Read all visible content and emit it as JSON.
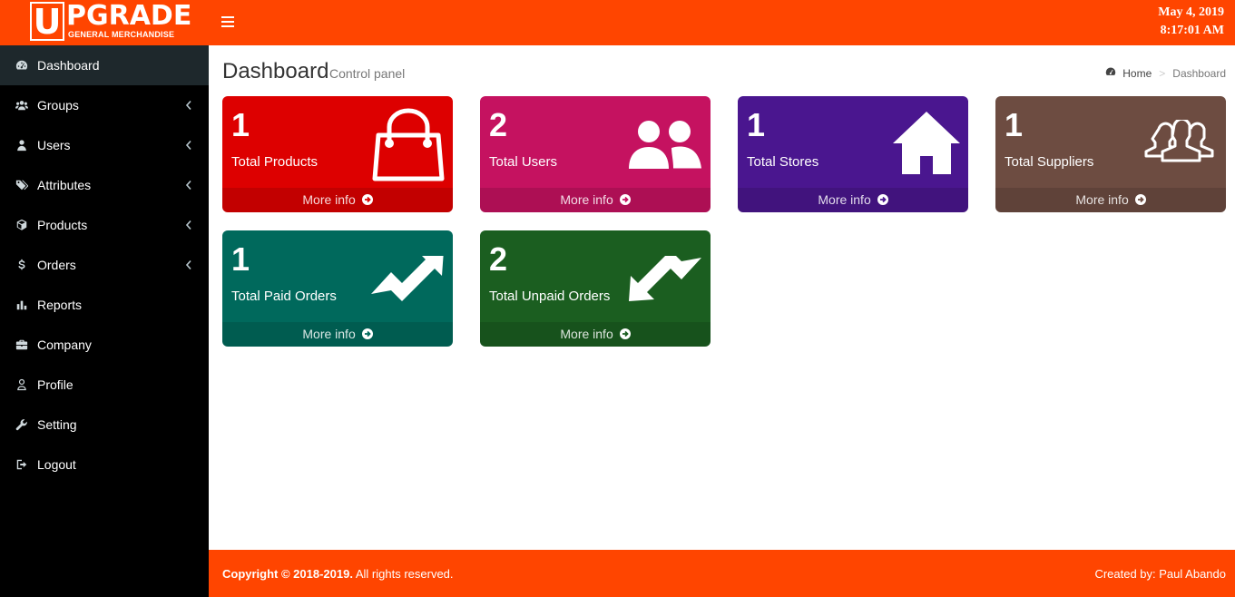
{
  "header": {
    "logo": {
      "first_letter": "U",
      "rest": "PGRADE",
      "subtitle": "GENERAL MERCHANDISE"
    },
    "menu_icon": "hamburger-icon",
    "date": "May 4, 2019",
    "time": "8:17:01 AM",
    "brand_color": "#ff4500"
  },
  "sidebar": {
    "items": [
      {
        "label": "Dashboard",
        "icon": "dashboard-icon",
        "active": true,
        "has_submenu": false
      },
      {
        "label": "Groups",
        "icon": "users-group-icon",
        "active": false,
        "has_submenu": true
      },
      {
        "label": "Users",
        "icon": "user-icon",
        "active": false,
        "has_submenu": true
      },
      {
        "label": "Attributes",
        "icon": "tags-icon",
        "active": false,
        "has_submenu": true
      },
      {
        "label": "Products",
        "icon": "cube-icon",
        "active": false,
        "has_submenu": true
      },
      {
        "label": "Orders",
        "icon": "dollar-icon",
        "active": false,
        "has_submenu": true
      },
      {
        "label": "Reports",
        "icon": "bar-chart-icon",
        "active": false,
        "has_submenu": false
      },
      {
        "label": "Company",
        "icon": "briefcase-icon",
        "active": false,
        "has_submenu": false
      },
      {
        "label": "Profile",
        "icon": "user-outline-icon",
        "active": false,
        "has_submenu": false
      },
      {
        "label": "Setting",
        "icon": "wrench-icon",
        "active": false,
        "has_submenu": false
      },
      {
        "label": "Logout",
        "icon": "sign-out-icon",
        "active": false,
        "has_submenu": false
      }
    ]
  },
  "page": {
    "title": "Dashboard",
    "subtitle": "Control panel",
    "breadcrumb": {
      "home": "Home",
      "current": "Dashboard"
    }
  },
  "cards": [
    {
      "count": "1",
      "label": "Total Products",
      "more": "More info",
      "color": "#dd0000",
      "icon": "shopping-bag-icon"
    },
    {
      "count": "2",
      "label": "Total Users",
      "more": "More info",
      "color": "#c51260",
      "icon": "users-icon"
    },
    {
      "count": "1",
      "label": "Total Stores",
      "more": "More info",
      "color": "#4a168f",
      "icon": "home-icon"
    },
    {
      "count": "1",
      "label": "Total Suppliers",
      "more": "More info",
      "color": "#6d4c41",
      "icon": "suppliers-icon"
    },
    {
      "count": "1",
      "label": "Total Paid Orders",
      "more": "More info",
      "color": "#00695c",
      "icon": "trend-up-icon"
    },
    {
      "count": "2",
      "label": "Total Unpaid Orders",
      "more": "More info",
      "color": "#1b5e20",
      "icon": "trend-down-icon"
    }
  ],
  "footer": {
    "copyright_bold": "Copyright © 2018-2019.",
    "copyright_rest": " All rights reserved.",
    "credit": "Created by: Paul Abando"
  }
}
